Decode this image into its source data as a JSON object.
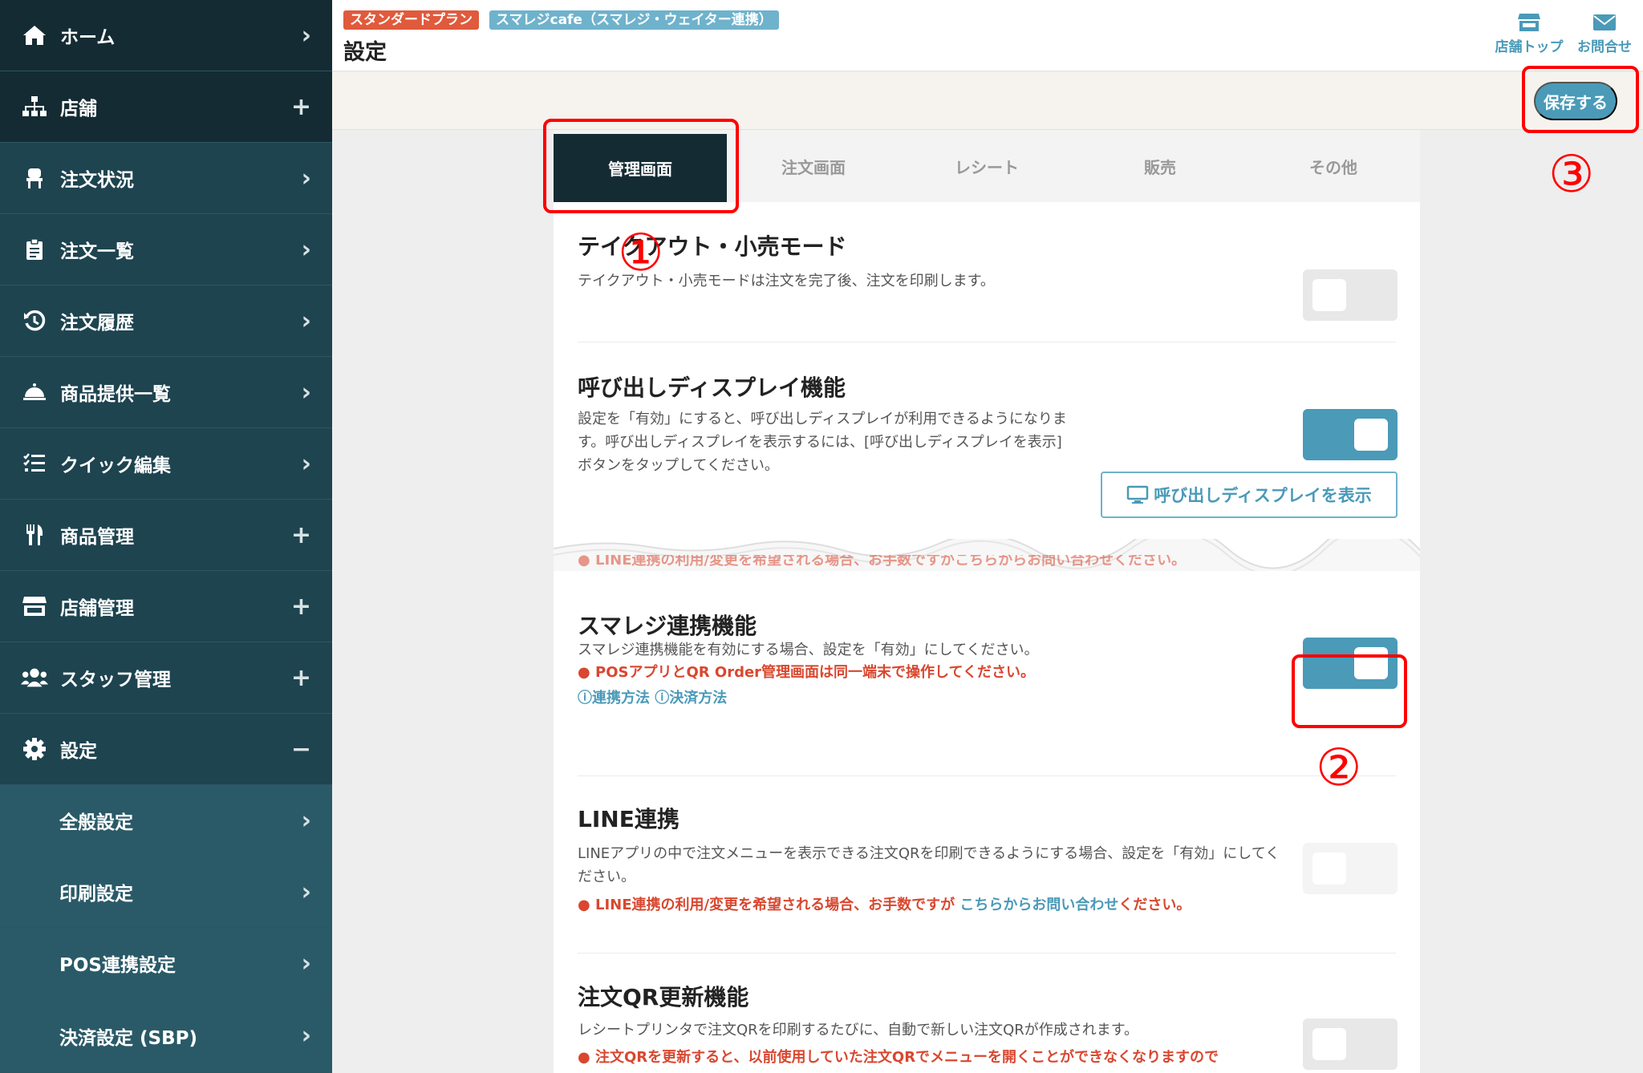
{
  "sidebar": {
    "items": [
      {
        "label": "ホーム",
        "icon": "home-icon",
        "mark": "›"
      },
      {
        "label": "店舗",
        "icon": "store-tree-icon",
        "mark": "+"
      },
      {
        "label": "注文状況",
        "icon": "chair-icon",
        "mark": "›"
      },
      {
        "label": "注文一覧",
        "icon": "clipboard-icon",
        "mark": "›"
      },
      {
        "label": "注文履歴",
        "icon": "history-icon",
        "mark": "›"
      },
      {
        "label": "商品提供一覧",
        "icon": "bell-icon",
        "mark": "›"
      },
      {
        "label": "クイック編集",
        "icon": "list-edit-icon",
        "mark": "›"
      },
      {
        "label": "商品管理",
        "icon": "utensils-icon",
        "mark": "+"
      },
      {
        "label": "店舗管理",
        "icon": "storefront-icon",
        "mark": "+"
      },
      {
        "label": "スタッフ管理",
        "icon": "users-icon",
        "mark": "+"
      },
      {
        "label": "設定",
        "icon": "gear-icon",
        "mark": "−"
      },
      {
        "label": "全般設定",
        "mark": "›"
      },
      {
        "label": "印刷設定",
        "mark": "›"
      },
      {
        "label": "POS連携設定",
        "mark": "›"
      },
      {
        "label": "決済設定 (SBP)",
        "mark": "›"
      }
    ]
  },
  "header": {
    "plan_badge": "スタンダードプラン",
    "store_badge": "スマレジcafe（スマレジ・ウェイター連携）",
    "title": "設定",
    "store_top": "店舗トップ",
    "contact": "お問合せ"
  },
  "actions": {
    "save_label": "保存する"
  },
  "tabs": [
    "管理画面",
    "注文画面",
    "レシート",
    "販売",
    "その他"
  ],
  "sections": {
    "takeout": {
      "title": "テイクアウト・小売モード",
      "desc": "テイクアウト・小売モードは注文を完了後、注文を印刷します。",
      "enabled": false
    },
    "call_display": {
      "title": "呼び出しディスプレイ機能",
      "desc": "設定を「有効」にすると、呼び出しディスプレイが利用できるようになります。呼び出しディスプレイを表示するには、[呼び出しディスプレイを表示]ボタンをタップしてください。",
      "button": "呼び出しディスプレイを表示",
      "enabled": true
    },
    "cut_warning": "LINE連携の利用/変更を希望される場合、お手数ですがこちらからお問い合わせください。",
    "smaregi": {
      "title": "スマレジ連携機能",
      "desc": "スマレジ連携機能を有効にする場合、設定を「有効」にしてください。",
      "warning": "POSアプリとQR Order管理画面は同一端末で操作してください。",
      "link1": "連携方法",
      "link2": "決済方法",
      "enabled": true
    },
    "line": {
      "title": "LINE連携",
      "desc": "LINEアプリの中で注文メニューを表示できる注文QRを印刷できるようにする場合、設定を「有効」にしてください。",
      "warning_pre": "LINE連携の利用/変更を希望される場合、お手数ですが ",
      "warning_link": "こちらからお問い合わせ",
      "warning_post": "ください。",
      "enabled": false
    },
    "qr_update": {
      "title": "注文QR更新機能",
      "desc": "レシートプリンタで注文QRを印刷するたびに、自動で新しい注文QRが作成されます。",
      "warning": "注文QRを更新すると、以前使用していた注文QRでメニューを開くことができなくなりますので",
      "enabled": false
    }
  },
  "annotations": [
    "①",
    "②",
    "③"
  ],
  "colors": {
    "sidebar": "#1e4450",
    "accent": "#4a9ab8",
    "warning": "#d9472f",
    "highlight": "#ff0000"
  }
}
